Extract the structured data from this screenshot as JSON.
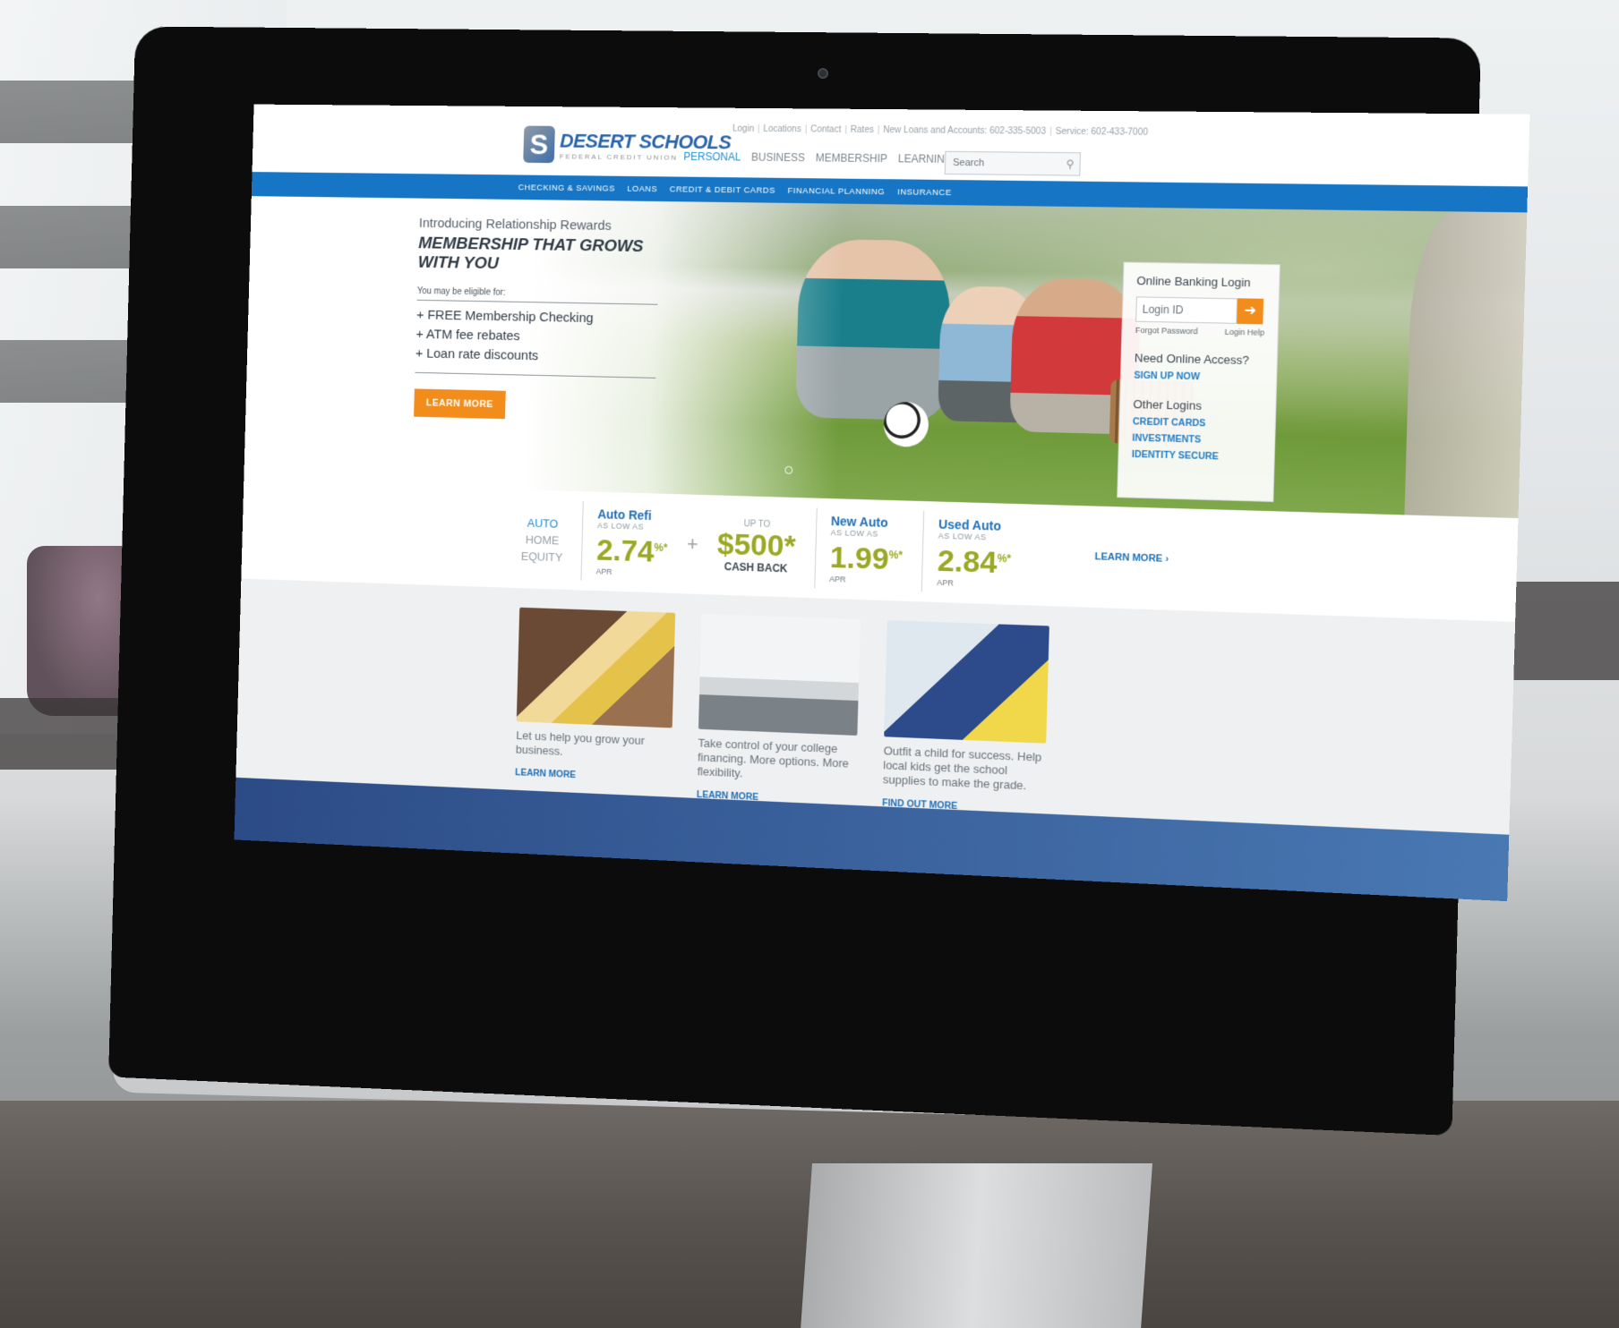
{
  "site": {
    "logo": {
      "name": "DESERT SCHOOLS",
      "sub": "FEDERAL CREDIT UNION",
      "mark": "S"
    },
    "utility_links": [
      "Login",
      "Locations",
      "Contact",
      "Rates",
      "New Loans and Accounts: 602-335-5003",
      "Service: 602-433-7000"
    ],
    "main_nav": [
      {
        "label": "PERSONAL",
        "active": true
      },
      {
        "label": "BUSINESS",
        "active": false
      },
      {
        "label": "MEMBERSHIP",
        "active": false
      },
      {
        "label": "LEARNING CENTER",
        "active": false
      }
    ],
    "search": {
      "placeholder": "Search"
    },
    "sub_nav": [
      "CHECKING & SAVINGS",
      "LOANS",
      "CREDIT & DEBIT CARDS",
      "FINANCIAL PLANNING",
      "INSURANCE"
    ]
  },
  "hero": {
    "intro": "Introducing Relationship Rewards",
    "title": "MEMBERSHIP THAT GROWS WITH YOU",
    "eligible": "You may be eligible for:",
    "items": [
      "+ FREE Membership Checking",
      "+ ATM fee rebates",
      "+ Loan rate discounts"
    ],
    "cta": "LEARN MORE"
  },
  "login_panel": {
    "title": "Online Banking Login",
    "login_placeholder": "Login ID",
    "go_icon": "arrow-right-icon",
    "forgot": "Forgot Password",
    "help": "Login Help",
    "access_heading": "Need Online Access?",
    "signup": "SIGN UP NOW",
    "other_heading": "Other Logins",
    "other_links": [
      "CREDIT CARDS",
      "INVESTMENTS",
      "IDENTITY SECURE"
    ]
  },
  "rates": {
    "tabs": [
      {
        "label": "AUTO",
        "active": true
      },
      {
        "label": "HOME",
        "active": false
      },
      {
        "label": "EQUITY",
        "active": false
      }
    ],
    "auto_refi": {
      "name": "Auto Refi",
      "sub": "AS LOW AS",
      "value": "2.74",
      "unit": "%*",
      "apr": "APR"
    },
    "cash_back": {
      "up_to": "UP TO",
      "value": "$500*",
      "label": "CASH BACK"
    },
    "new_auto": {
      "name": "New Auto",
      "sub": "AS LOW AS",
      "value": "1.99",
      "unit": "%*",
      "apr": "APR"
    },
    "used_auto": {
      "name": "Used Auto",
      "sub": "AS LOW AS",
      "value": "2.84",
      "unit": "%*",
      "apr": "APR"
    },
    "plus": "+",
    "learn_more": "LEARN MORE ›"
  },
  "promos": [
    {
      "text": "Let us help you grow your business.",
      "link": "LEARN MORE"
    },
    {
      "text": "Take control of your college financing. More options. More flexibility.",
      "link": "LEARN MORE"
    },
    {
      "text": "Outfit a child for success. Help local kids get the school supplies to make the grade.",
      "link": "FIND OUT MORE"
    }
  ],
  "colors": {
    "brand_blue": "#1676c5",
    "accent_orange": "#f28c1a",
    "rate_green": "#9aa824",
    "footer_blue": "#2c4b86"
  }
}
